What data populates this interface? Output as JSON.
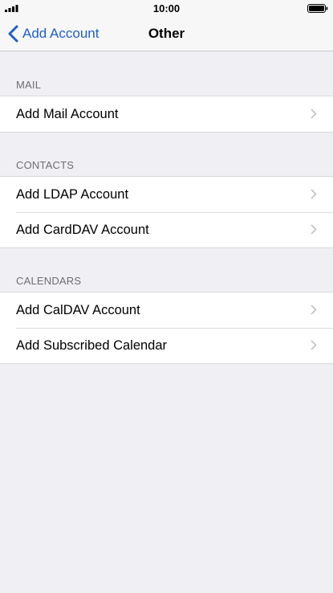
{
  "status_bar": {
    "time": "10:00"
  },
  "nav": {
    "back_label": "Add Account",
    "title": "Other"
  },
  "sections": [
    {
      "header": "MAIL",
      "rows": [
        "Add Mail Account"
      ]
    },
    {
      "header": "CONTACTS",
      "rows": [
        "Add LDAP Account",
        "Add CardDAV Account"
      ]
    },
    {
      "header": "CALENDARS",
      "rows": [
        "Add CalDAV Account",
        "Add Subscribed Calendar"
      ]
    }
  ],
  "colors": {
    "accent": "#1f5fc9",
    "background": "#efeff4",
    "section_header": "#6d6d72",
    "chevron": "#c4c4c7"
  },
  "icons": {
    "signal": "cellular-signal-icon",
    "battery": "battery-icon",
    "back": "chevron-left-icon",
    "row": "chevron-right-icon"
  }
}
